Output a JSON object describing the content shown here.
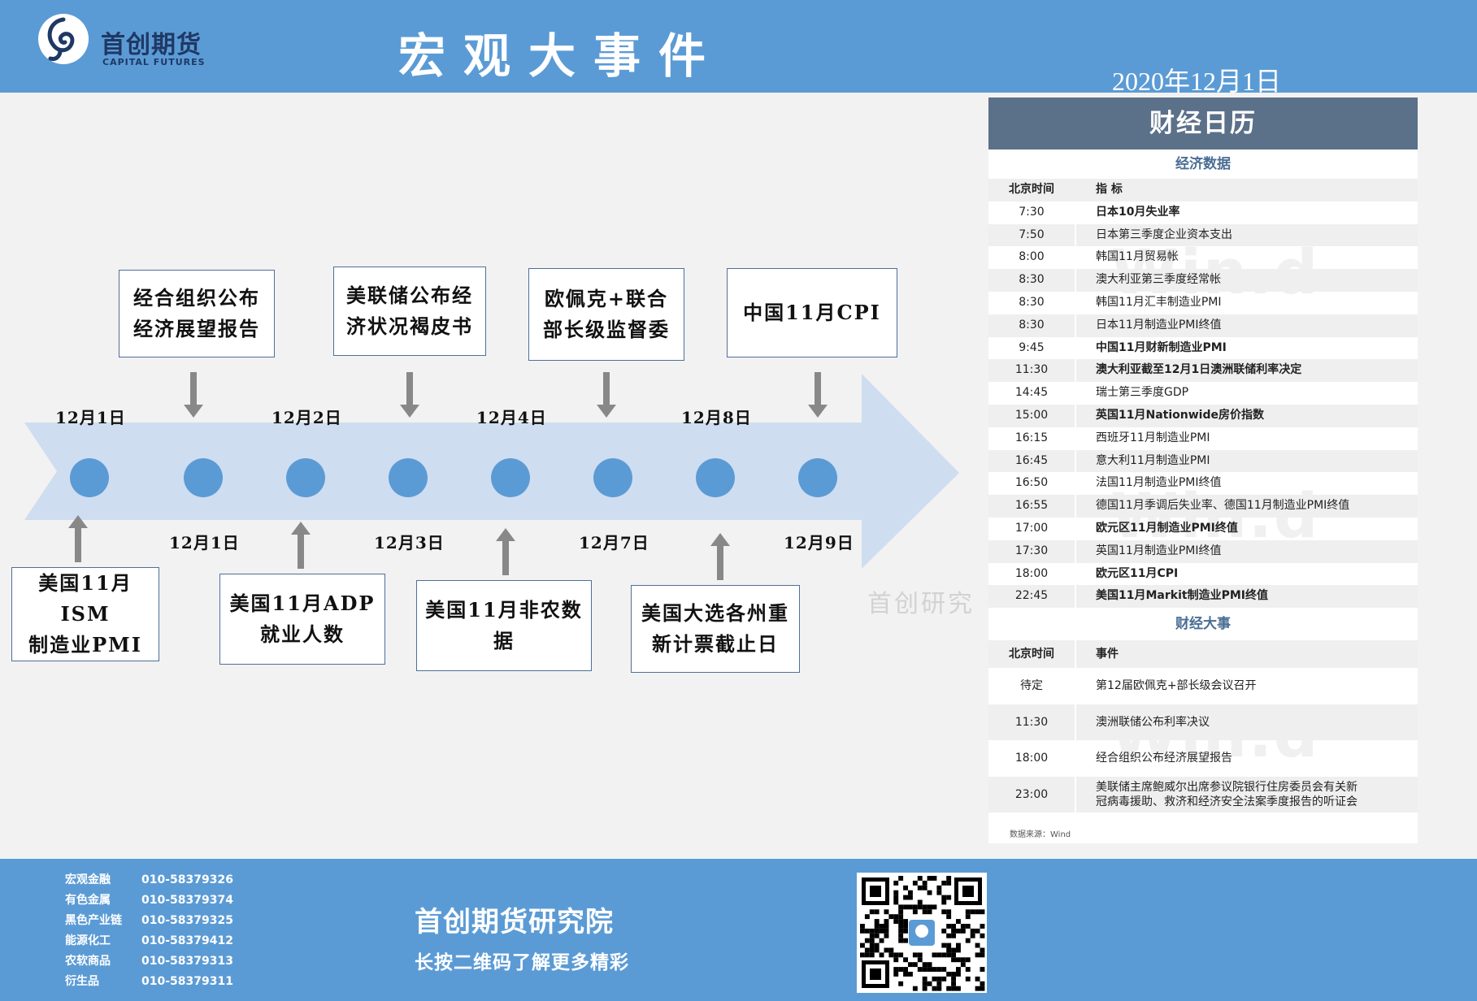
{
  "header": {
    "logo_cn": "首创期货",
    "logo_en": "CAPITAL FUTURES",
    "title": "宏观大事件",
    "date": "2020年12月1日"
  },
  "timeline": {
    "top_dates": [
      "12月1日",
      "12月2日",
      "12月4日",
      "12月8日"
    ],
    "bottom_dates": [
      "12月1日",
      "12月3日",
      "12月7日",
      "12月9日"
    ],
    "events_above": [
      {
        "lines": [
          "经合组织公布",
          "经济展望报告"
        ]
      },
      {
        "lines": [
          "美联储公布经",
          "济状况褐皮书"
        ]
      },
      {
        "lines": [
          "欧佩克+联合",
          "部长级监督委"
        ]
      },
      {
        "lines": [
          "中国11月CPI"
        ]
      }
    ],
    "events_below": [
      {
        "lines": [
          "美国11月ISM",
          "制造业PMI"
        ]
      },
      {
        "lines": [
          "美国11月ADP",
          "就业人数"
        ]
      },
      {
        "lines": [
          "美国11月非农数",
          "据"
        ]
      },
      {
        "lines": [
          "美国大选各州重",
          "新计票截止日"
        ]
      }
    ],
    "arrow_color": "#cfddf0",
    "dot_color": "#5b9bd5"
  },
  "watermark": "首创研究",
  "calendar": {
    "title": "财经日历",
    "econ_section": "经济数据",
    "econ_header": {
      "time": "北京时间",
      "item": "指  标"
    },
    "econ_rows": [
      {
        "time": "7:30",
        "item": "日本10月失业率",
        "bold": true
      },
      {
        "time": "7:50",
        "item": "日本第三季度企业资本支出",
        "bold": false
      },
      {
        "time": "8:00",
        "item": "韩国11月贸易帐",
        "bold": false
      },
      {
        "time": "8:30",
        "item": "澳大利亚第三季度经常帐",
        "bold": false
      },
      {
        "time": "8:30",
        "item": "韩国11月汇丰制造业PMI",
        "bold": false
      },
      {
        "time": "8:30",
        "item": "日本11月制造业PMI终值",
        "bold": false
      },
      {
        "time": "9:45",
        "item": "中国11月财新制造业PMI",
        "bold": true
      },
      {
        "time": "11:30",
        "item": "澳大利亚截至12月1日澳洲联储利率决定",
        "bold": true
      },
      {
        "time": "14:45",
        "item": "瑞士第三季度GDP",
        "bold": false
      },
      {
        "time": "15:00",
        "item": "英国11月Nationwide房价指数",
        "bold": true
      },
      {
        "time": "16:15",
        "item": "西班牙11月制造业PMI",
        "bold": false
      },
      {
        "time": "16:45",
        "item": "意大利11月制造业PMI",
        "bold": false
      },
      {
        "time": "16:50",
        "item": "法国11月制造业PMI终值",
        "bold": false
      },
      {
        "time": "16:55",
        "item": "德国11月季调后失业率、德国11月制造业PMI终值",
        "bold": false
      },
      {
        "time": "17:00",
        "item": "欧元区11月制造业PMI终值",
        "bold": true
      },
      {
        "time": "17:30",
        "item": "英国11月制造业PMI终值",
        "bold": false
      },
      {
        "time": "18:00",
        "item": "欧元区11月CPI",
        "bold": true
      },
      {
        "time": "22:45",
        "item": "美国11月Markit制造业PMI终值",
        "bold": true
      }
    ],
    "events_section": "财经大事",
    "events_header": {
      "time": "北京时间",
      "item": "事件"
    },
    "event_rows": [
      {
        "time": "待定",
        "lines": [
          "第12届欧佩克+部长级会议召开"
        ]
      },
      {
        "time": "11:30",
        "lines": [
          "澳洲联储公布利率决议"
        ]
      },
      {
        "time": "18:00",
        "lines": [
          "经合组织公布经济展望报告"
        ]
      },
      {
        "time": "23:00",
        "lines": [
          "美联储主席鲍威尔出席参议院银行住房委员会有关新",
          "冠病毒援助、救济和经济安全法案季度报告的听证会"
        ]
      }
    ],
    "source": "数据来源：Wind",
    "background_watermark": "Win.d"
  },
  "footer": {
    "contacts": [
      {
        "dept": "宏观金融",
        "phone": "010-58379326"
      },
      {
        "dept": "有色金属",
        "phone": "010-58379374"
      },
      {
        "dept": "黑色产业链",
        "phone": "010-58379325"
      },
      {
        "dept": "能源化工",
        "phone": "010-58379412"
      },
      {
        "dept": "农软商品",
        "phone": "010-58379313"
      },
      {
        "dept": "衍生品",
        "phone": "010-58379311"
      }
    ],
    "institute": "首创期货研究院",
    "slogan": "长按二维码了解更多精彩",
    "qr_icon": "qr-code-icon"
  }
}
